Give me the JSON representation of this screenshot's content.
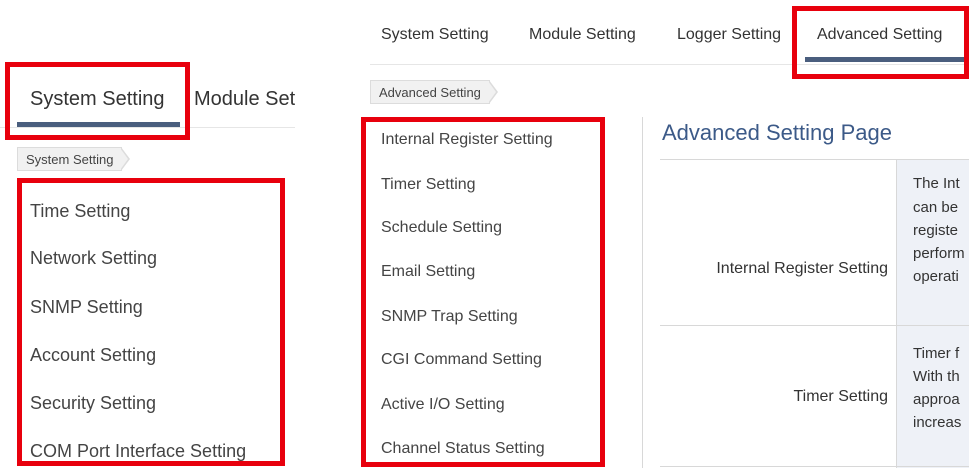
{
  "left_panel": {
    "tabs": [
      "System Setting",
      "Module Set"
    ],
    "breadcrumb": "System Setting",
    "menu": [
      "Time Setting",
      "Network Setting",
      "SNMP Setting",
      "Account Setting",
      "Security Setting",
      "COM Port Interface Setting"
    ]
  },
  "right_panel": {
    "tabs": [
      "System Setting",
      "Module Setting",
      "Logger Setting",
      "Advanced Setting"
    ],
    "breadcrumb": "Advanced Setting",
    "menu": [
      "Internal Register Setting",
      "Timer Setting",
      "Schedule Setting",
      "Email Setting",
      "SNMP Trap Setting",
      "CGI Command Setting",
      "Active I/O Setting",
      "Channel Status Setting"
    ],
    "page_title": "Advanced Setting Page",
    "table": [
      {
        "label": "Internal Register Setting",
        "desc": [
          "The Int",
          "can be",
          "registe",
          "perform",
          "operati"
        ]
      },
      {
        "label": "Timer Setting",
        "desc": [
          "Timer f",
          "With th",
          "approa",
          "increas"
        ]
      }
    ]
  },
  "colors": {
    "highlight_box": "#e8000d",
    "active_tab_underline": "#4a5e7e",
    "title": "#3c5a88"
  }
}
